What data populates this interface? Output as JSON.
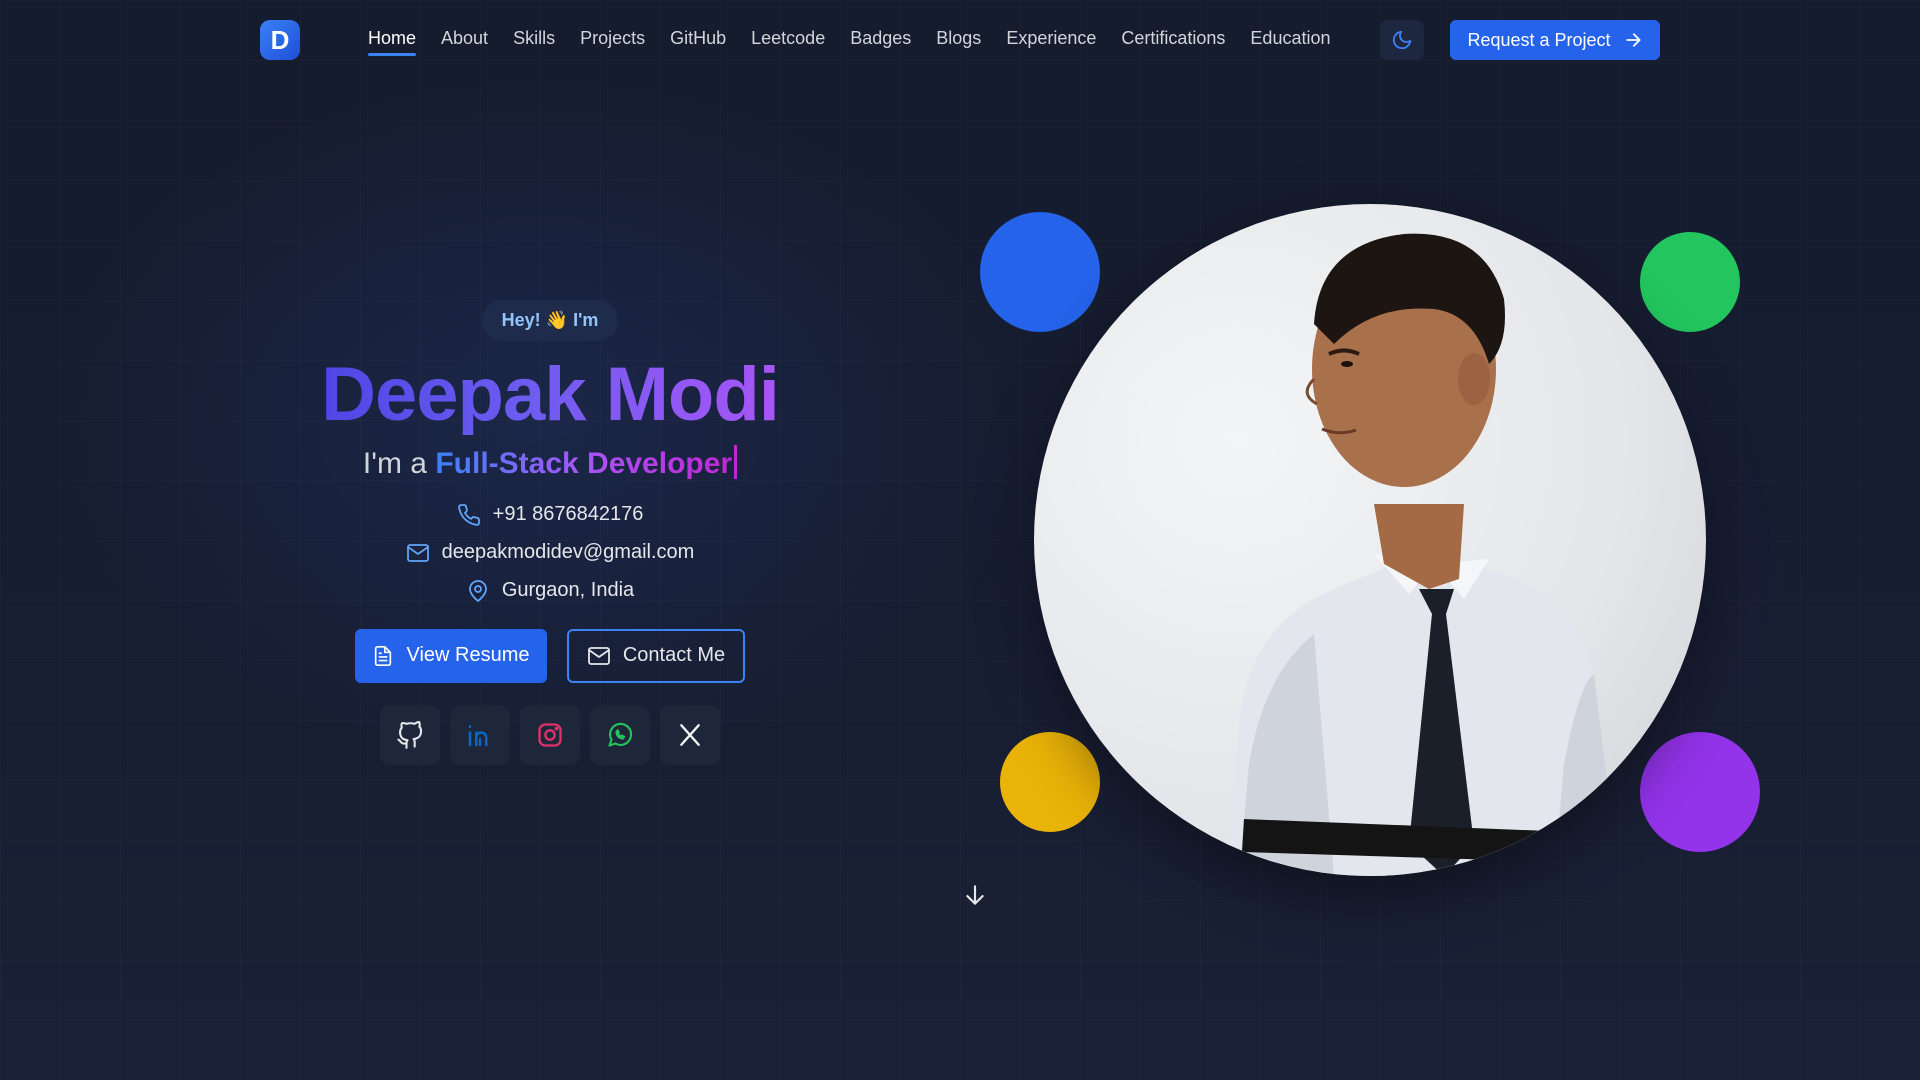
{
  "nav": {
    "logo_letter": "D",
    "links": [
      {
        "label": "Home",
        "active": true
      },
      {
        "label": "About"
      },
      {
        "label": "Skills"
      },
      {
        "label": "Projects"
      },
      {
        "label": "GitHub"
      },
      {
        "label": "Leetcode"
      },
      {
        "label": "Badges"
      },
      {
        "label": "Blogs"
      },
      {
        "label": "Experience"
      },
      {
        "label": "Certifications"
      },
      {
        "label": "Education"
      }
    ],
    "theme_icon": "moon-icon",
    "cta_label": "Request a Project"
  },
  "hero": {
    "greeting": "Hey! 👋 I'm",
    "name": "Deepak Modi",
    "role_prefix": "I'm a",
    "role_highlight": "Full-Stack Developer",
    "contacts": {
      "phone": "+91 8676842176",
      "email": "deepakmodidev@gmail.com",
      "location": "Gurgaon, India"
    },
    "buttons": {
      "resume": "View Resume",
      "contact": "Contact Me"
    },
    "socials": [
      "github-icon",
      "linkedin-icon",
      "instagram-icon",
      "whatsapp-icon",
      "x-icon"
    ]
  },
  "colors": {
    "accent": "#2563eb",
    "blob_blue": "#2563eb",
    "blob_green": "#22c55e",
    "blob_yellow": "#eab308",
    "blob_purple": "#9333ea"
  }
}
